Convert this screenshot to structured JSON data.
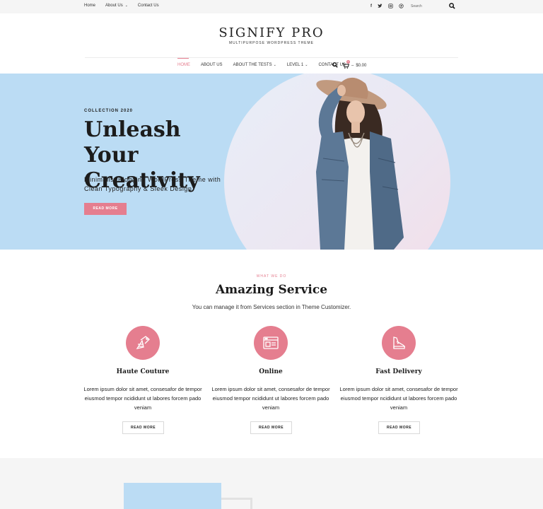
{
  "topbar": {
    "links": [
      {
        "label": "Home",
        "caret": false
      },
      {
        "label": "About Us",
        "caret": true
      },
      {
        "label": "Contact Us",
        "caret": false
      }
    ],
    "social_icons": [
      "facebook-icon",
      "twitter-icon",
      "instagram-icon",
      "pinterest-icon"
    ],
    "search_placeholder": "Search"
  },
  "header": {
    "logo": "SIGNIFY PRO",
    "tagline": "MULTIPURPOSE WORDPRESS THEME"
  },
  "nav": {
    "items": [
      {
        "label": "HOME",
        "active": true,
        "caret": false
      },
      {
        "label": "ABOUT US",
        "active": false,
        "caret": false
      },
      {
        "label": "ABOUT THE TESTS",
        "active": false,
        "caret": true
      },
      {
        "label": "LEVEL 1",
        "active": false,
        "caret": true
      },
      {
        "label": "CONTACT US",
        "active": false,
        "caret": false
      }
    ],
    "cart_count": "0",
    "cart_total": "$0.00"
  },
  "hero": {
    "eyebrow": "COLLECTION 2020",
    "title": "Unleash Your Creativity",
    "subtitle": "Minimalist Blogging WordPress Theme with Clean Typography & Sleek Design",
    "button": "READ MORE"
  },
  "services": {
    "eyebrow": "WHAT WE DO",
    "title": "Amazing Service",
    "subtitle": "You can manage it from Services section in Theme Customizer.",
    "items": [
      {
        "icon": "sewing-icon",
        "name": "Haute Couture",
        "desc": "Lorem ipsum dolor sit amet, consesafor de tempor eiusmod tempor ncididunt ut labores forcem pado veniam",
        "button": "READ MORE"
      },
      {
        "icon": "browser-window-icon",
        "name": "Online",
        "desc": "Lorem ipsum dolor sit amet, consesafor de tempor eiusmod tempor ncididunt ut labores forcem pado veniam",
        "button": "READ MORE"
      },
      {
        "icon": "shoe-icon",
        "name": "Fast Delivery",
        "desc": "Lorem ipsum dolor sit amet, consesafor de tempor eiusmod tempor ncididunt ut labores forcem pado veniam",
        "button": "READ MORE"
      }
    ]
  },
  "colors": {
    "accent": "#e57e8f",
    "hero_bg": "#bbdcf4",
    "topbar_bg": "#f5f5f5"
  }
}
